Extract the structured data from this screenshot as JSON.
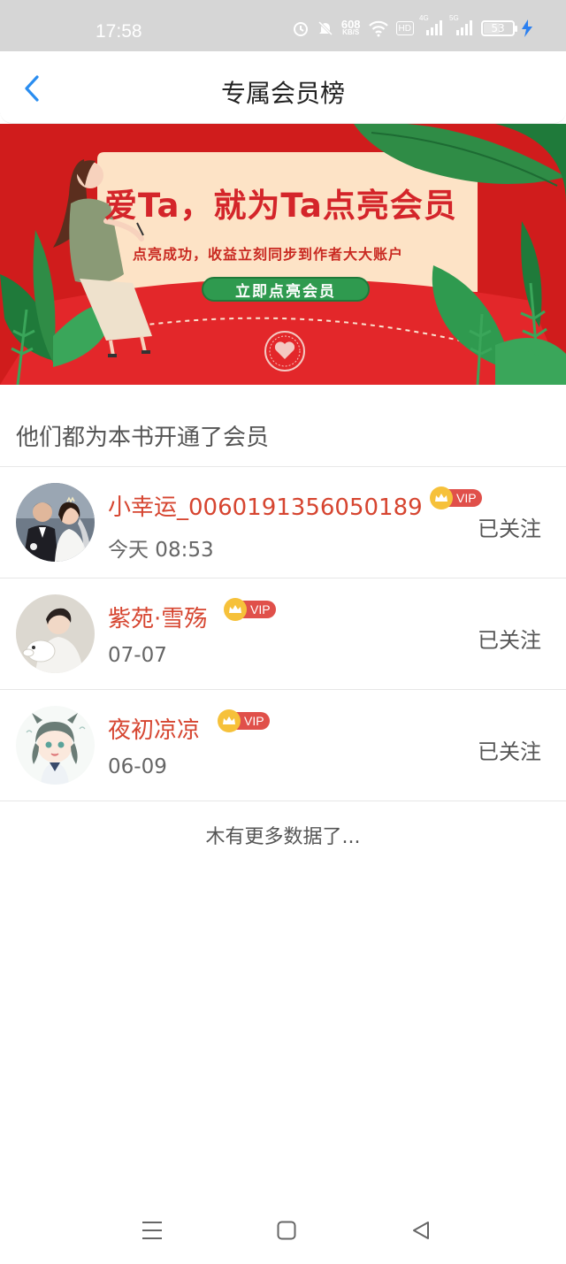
{
  "status_bar": {
    "time": "17:58",
    "net_speed_value": "608",
    "net_speed_unit": "KB/S",
    "hd_label": "HD",
    "signal1_label": "4G",
    "signal2_label": "5G",
    "battery_level": "53",
    "icons": [
      "alarm-icon",
      "mute-bell-icon",
      "wifi-icon",
      "hd-icon",
      "signal-4g-icon",
      "signal-5g-icon",
      "battery-icon",
      "charging-icon"
    ]
  },
  "header": {
    "title": "专属会员榜",
    "back_icon": "chevron-left-icon"
  },
  "banner": {
    "headline": "爱Ta，就为Ta点亮会员",
    "subtitle": "点亮成功，收益立刻同步到作者大大账户",
    "button_label": "立即点亮会员",
    "colors": {
      "background": "#d01c1c",
      "card": "#fde3c6",
      "button": "#2f9a4f"
    }
  },
  "section_title": "他们都为本书开通了会员",
  "members": [
    {
      "name": "小幸运_0060191356050189",
      "vip_label": "VIP",
      "time": "今天 08:53",
      "follow_status": "已关注",
      "avatar": "wedding-couple-avatar"
    },
    {
      "name": "紫苑·雪殇",
      "vip_label": "VIP",
      "time": "07-07",
      "follow_status": "已关注",
      "avatar": "young-man-avatar"
    },
    {
      "name": "夜初凉凉",
      "vip_label": "VIP",
      "time": "06-09",
      "follow_status": "已关注",
      "avatar": "anime-girl-avatar"
    }
  ],
  "footer_text": "木有更多数据了...",
  "nav_bar": {
    "icons": [
      "menu-icon",
      "home-square-icon",
      "back-triangle-icon"
    ]
  },
  "colors": {
    "accent_blue": "#2a8df0",
    "name_red": "#d64530",
    "vip_red": "#e0504a",
    "crown_gold": "#f6c13a"
  }
}
